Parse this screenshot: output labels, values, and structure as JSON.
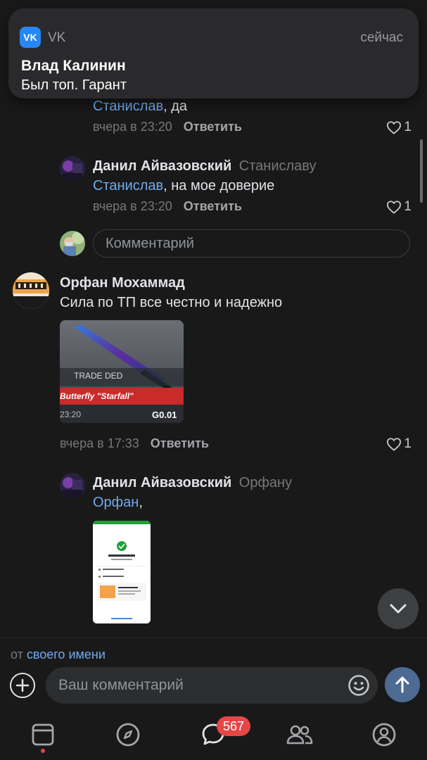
{
  "notification": {
    "app_icon_text": "VK",
    "app_name": "VK",
    "time": "сейчас",
    "title": "Влад Калинин",
    "body": "Был топ. Гарант"
  },
  "comments": {
    "c1": {
      "mention": "Станислав",
      "text": ", да",
      "time": "вчера в 23:20",
      "reply_label": "Ответить",
      "likes": "1"
    },
    "c2": {
      "author": "Данил Айвазовский",
      "reply_to": "Станиславу",
      "mention": "Станислав",
      "text": ", на мое доверие",
      "time": "вчера в 23:20",
      "reply_label": "Ответить",
      "likes": "1"
    },
    "thread_input_placeholder": "Комментарий",
    "c3": {
      "author": "Орфан Мохаммад",
      "text": "Сила по ТП все честно и надежно",
      "image": {
        "label": "TRADE DED",
        "item_name": "Butterfly \"Starfall\"",
        "time": "23:20",
        "price": "G0.01"
      },
      "time": "вчера в 17:33",
      "reply_label": "Ответить",
      "likes": "1"
    },
    "c4": {
      "author": "Данил Айвазовский",
      "reply_to": "Орфану",
      "mention": "Орфан",
      "text": ","
    }
  },
  "compose": {
    "from_prefix": "от",
    "from_link": "своего имени",
    "placeholder": "Ваш комментарий"
  },
  "tabbar": {
    "messages_badge": "567"
  },
  "colors": {
    "background": "#19191a",
    "link": "#71aaeb",
    "badge": "#e64646",
    "send": "#4d6a92"
  }
}
